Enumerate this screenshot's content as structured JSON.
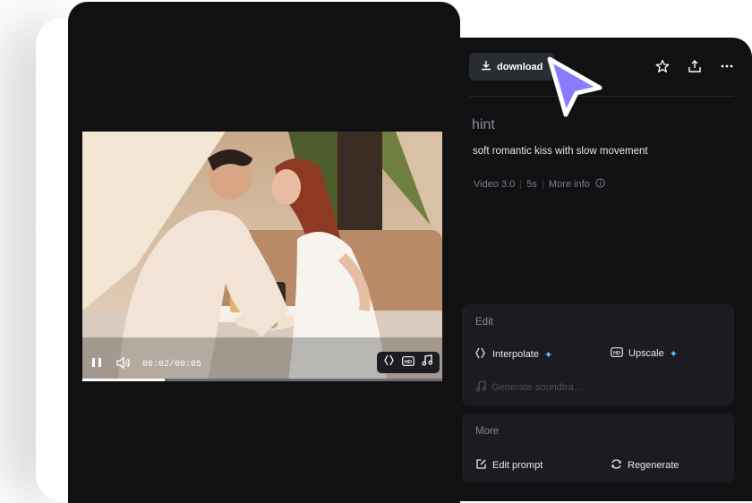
{
  "player": {
    "time_display": "00:02/00:05",
    "progress_fraction": 0.23,
    "controls": {
      "pause_icon": "pause-icon",
      "volume_icon": "volume-icon",
      "chips": [
        "interpolate-icon",
        "hd-icon",
        "music-note-icon"
      ]
    }
  },
  "panel": {
    "download_label": "download",
    "top_actions": [
      "star-icon",
      "share-icon",
      "more-icon"
    ],
    "hint_label": "hint",
    "prompt_text": "soft romantic kiss with slow movement",
    "meta": {
      "model": "Video 3.0",
      "duration": "5s",
      "more_info": "More info"
    },
    "edit": {
      "title": "Edit",
      "interpolate_label": "Interpolate",
      "upscale_label": "Upscale",
      "soundtrack_label": "Generate soundtra..."
    },
    "more": {
      "title": "More",
      "edit_prompt_label": "Edit prompt",
      "regenerate_label": "Regenerate"
    }
  },
  "colors": {
    "background": "#ffffff",
    "panel": "#111114",
    "card": "#1b1c21",
    "accent_sparkle": "#5ec8ff",
    "cursor": "#8b7cff"
  }
}
